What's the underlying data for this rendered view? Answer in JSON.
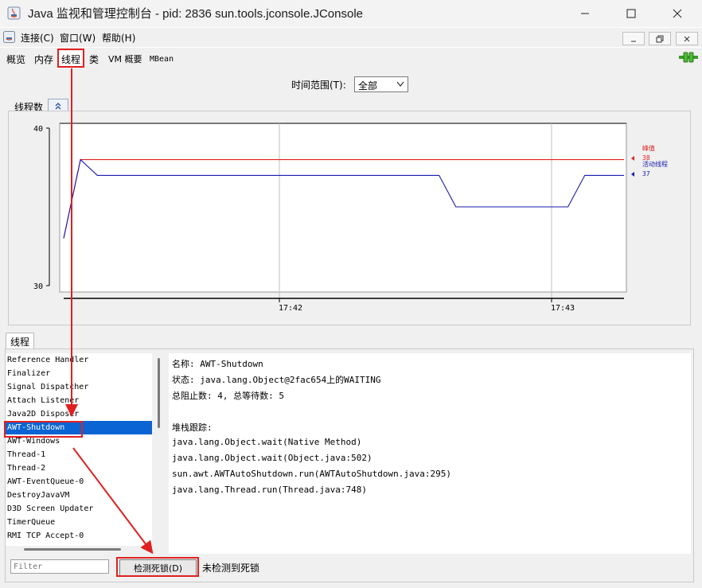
{
  "window": {
    "title": "Java 监视和管理控制台 - pid: 2836 sun.tools.jconsole.JConsole"
  },
  "menu": {
    "items": [
      "连接(C)",
      "窗口(W)",
      "帮助(H)"
    ]
  },
  "tabs": [
    "概览",
    "内存",
    "线程",
    "类",
    "VM 概要",
    "MBean"
  ],
  "selected_tab": "线程",
  "time_range": {
    "label": "时间范围(T):",
    "value": "全部"
  },
  "chart_section": {
    "title": "线程数"
  },
  "chart_data": {
    "type": "line",
    "title": "线程数",
    "x_ticks": [
      "17:42",
      "17:43"
    ],
    "ylim": [
      30,
      40
    ],
    "y_ticks": [
      "40",
      "30"
    ],
    "series": [
      {
        "name": "峰值",
        "current": "38",
        "color": "#e02020",
        "points": [
          [
            0,
            33
          ],
          [
            0.03,
            38
          ],
          [
            1,
            38
          ]
        ]
      },
      {
        "name": "活动线程",
        "current": "37",
        "color": "#1a1ab0",
        "points": [
          [
            0,
            33
          ],
          [
            0.03,
            38
          ],
          [
            0.06,
            37
          ],
          [
            0.67,
            37
          ],
          [
            0.7,
            35
          ],
          [
            0.9,
            35
          ],
          [
            0.93,
            37
          ],
          [
            1,
            37
          ]
        ]
      }
    ],
    "grid": true,
    "legend": "right"
  },
  "threads": {
    "tab_label": "线程",
    "list": [
      "Reference Handler",
      "Finalizer",
      "Signal Dispatcher",
      "Attach Listener",
      "Java2D Disposer",
      "AWT-Shutdown",
      "AWT-Windows",
      "Thread-1",
      "Thread-2",
      "AWT-EventQueue-0",
      "DestroyJavaVM",
      "D3D Screen Updater",
      "TimerQueue",
      "RMI TCP Accept-0"
    ],
    "selected": "AWT-Shutdown",
    "details": [
      "名称: AWT-Shutdown",
      "状态: java.lang.Object@2fac654上的WAITING",
      "总阻止数: 4, 总等待数: 5",
      "",
      "堆栈跟踪:",
      "java.lang.Object.wait(Native Method)",
      "java.lang.Object.wait(Object.java:502)",
      "sun.awt.AWTAutoShutdown.run(AWTAutoShutdown.java:295)",
      "java.lang.Thread.run(Thread.java:748)"
    ],
    "filter_placeholder": "Filter",
    "deadlock_button": "检测死锁(D)",
    "deadlock_status": "未检测到死锁"
  }
}
